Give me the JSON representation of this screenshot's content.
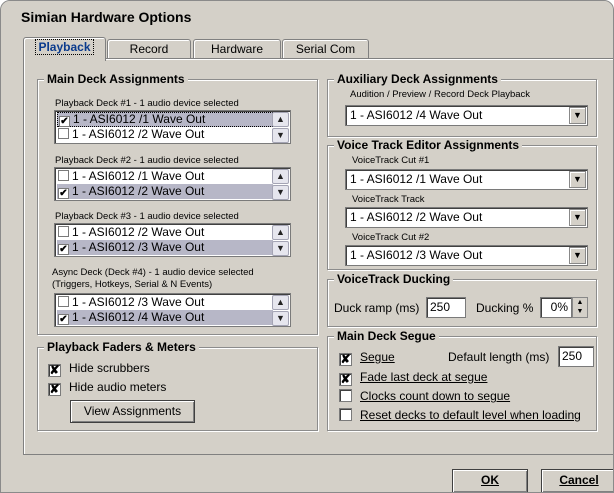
{
  "window": {
    "title": "Simian Hardware Options"
  },
  "tabs": [
    {
      "label": "Playback",
      "active": true
    },
    {
      "label": "Record",
      "active": false
    },
    {
      "label": "Hardware",
      "active": false
    },
    {
      "label": "Serial Com",
      "active": false
    }
  ],
  "main_deck": {
    "title": "Main Deck Assignments",
    "decks": [
      {
        "label": "Playback Deck #1 - 1 audio device selected",
        "items": [
          {
            "text": "1 - ASI6012 /1 Wave Out",
            "checked": true,
            "highlighted": true
          },
          {
            "text": "1 - ASI6012 /2 Wave Out",
            "checked": false,
            "highlighted": false
          }
        ]
      },
      {
        "label": "Playback Deck #2 - 1 audio device selected",
        "items": [
          {
            "text": "1 - ASI6012 /1 Wave Out",
            "checked": false,
            "highlighted": false
          },
          {
            "text": "1 - ASI6012 /2 Wave Out",
            "checked": true,
            "highlighted": true
          }
        ]
      },
      {
        "label": "Playback Deck #3 - 1 audio device selected",
        "items": [
          {
            "text": "1 - ASI6012 /2 Wave Out",
            "checked": false,
            "highlighted": false
          },
          {
            "text": "1 - ASI6012 /3 Wave Out",
            "checked": true,
            "highlighted": true
          }
        ]
      },
      {
        "label": "Async Deck (Deck #4) - 1 audio device selected",
        "label2": "(Triggers, Hotkeys, Serial & N Events)",
        "items": [
          {
            "text": "1 - ASI6012 /3 Wave Out",
            "checked": false,
            "highlighted": false
          },
          {
            "text": "1 - ASI6012 /4 Wave Out",
            "checked": true,
            "highlighted": true
          }
        ]
      }
    ]
  },
  "faders": {
    "title": "Playback Faders & Meters",
    "hide_scrubbers": {
      "label": "Hide scrubbers",
      "checked": true
    },
    "hide_meters": {
      "label": "Hide audio meters",
      "checked": true
    },
    "view_button": "View Assignments"
  },
  "aux": {
    "title": "Auxiliary Deck Assignments",
    "label": "Audition / Preview / Record Deck Playback",
    "value": "1 - ASI6012 /4 Wave Out"
  },
  "voice_editor": {
    "title": "Voice Track Editor Assignments",
    "fields": [
      {
        "label": "VoiceTrack Cut #1",
        "value": "1 - ASI6012 /1 Wave Out"
      },
      {
        "label": "VoiceTrack Track",
        "value": "1 - ASI6012 /2 Wave Out"
      },
      {
        "label": "VoiceTrack Cut #2",
        "value": "1 - ASI6012 /3 Wave Out"
      }
    ]
  },
  "ducking": {
    "title": "VoiceTrack Ducking",
    "ramp_label": "Duck ramp (ms)",
    "ramp_value": "250",
    "pct_label": "Ducking %",
    "pct_value": "0%"
  },
  "segue": {
    "title": "Main Deck Segue",
    "segue": {
      "label": "Segue",
      "checked": true
    },
    "default_length_label": "Default length (ms)",
    "default_length_value": "250",
    "fade_last": {
      "label": "Fade last deck at segue",
      "checked": true
    },
    "clocks": {
      "label": "Clocks count down to segue",
      "checked": false
    },
    "reset": {
      "label": "Reset decks to default level when loading",
      "checked": false
    }
  },
  "buttons": {
    "ok": "OK",
    "cancel": "Cancel"
  },
  "icons": {
    "scroll_up": "▲",
    "scroll_down": "▼",
    "dropdown": "▼",
    "check": "✔",
    "cross_check": "✘"
  }
}
